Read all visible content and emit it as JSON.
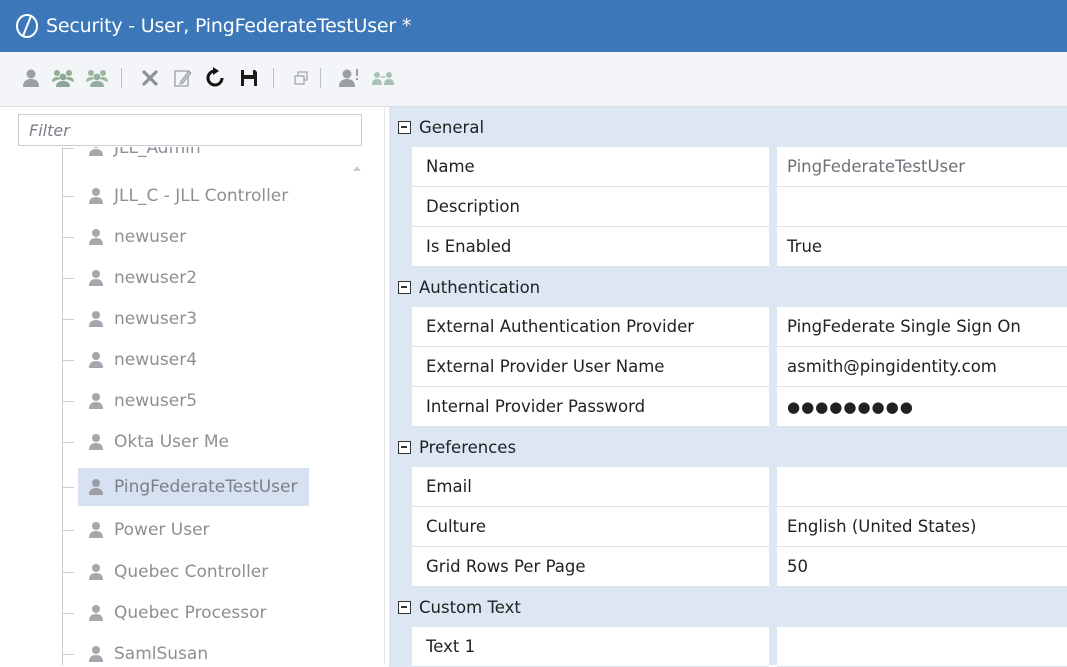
{
  "window": {
    "title": "Security - User, PingFederateTestUser *",
    "accent": "#3c78b9"
  },
  "toolbar": {
    "icons": [
      "user-icon",
      "user-group-icon",
      "user-group-alt-icon",
      "delete-icon",
      "edit-icon",
      "refresh-icon",
      "save-icon",
      "restore-window-icon",
      "user-alert-icon",
      "users-link-icon"
    ]
  },
  "filter": {
    "placeholder": "Filter",
    "value": ""
  },
  "tree": {
    "items": [
      {
        "label": "JLL_Admin"
      },
      {
        "label": "JLL_C - JLL Controller"
      },
      {
        "label": "newuser"
      },
      {
        "label": "newuser2"
      },
      {
        "label": "newuser3"
      },
      {
        "label": "newuser4"
      },
      {
        "label": "newuser5"
      },
      {
        "label": "Okta User Me"
      },
      {
        "label": "PingFederateTestUser",
        "selected": true
      },
      {
        "label": "Power User"
      },
      {
        "label": "Quebec Controller"
      },
      {
        "label": "Quebec Processor"
      },
      {
        "label": "SamlSusan"
      }
    ]
  },
  "properties": {
    "general": {
      "header": "General",
      "name_label": "Name",
      "name_value": "PingFederateTestUser",
      "description_label": "Description",
      "description_value": "",
      "enabled_label": "Is Enabled",
      "enabled_value": "True"
    },
    "authentication": {
      "header": "Authentication",
      "provider_label": "External Authentication Provider",
      "provider_value": "PingFederate Single Sign On",
      "username_label": "External Provider User Name",
      "username_value": "asmith@pingidentity.com",
      "password_label": "Internal Provider Password",
      "password_value": "●●●●●●●●●"
    },
    "preferences": {
      "header": "Preferences",
      "email_label": "Email",
      "email_value": "",
      "culture_label": "Culture",
      "culture_value": "English (United States)",
      "rows_label": "Grid Rows Per Page",
      "rows_value": "50"
    },
    "custom_text": {
      "header": "Custom Text",
      "text1_label": "Text 1",
      "text1_value": ""
    }
  }
}
